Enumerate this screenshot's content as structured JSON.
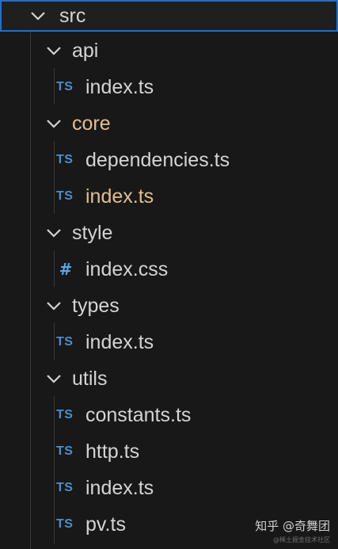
{
  "tree": {
    "root": {
      "label": "src",
      "icon": "chevron-down-icon"
    },
    "folders": [
      {
        "label": "api",
        "files": [
          {
            "label": "index.ts",
            "icon": "TS"
          }
        ]
      },
      {
        "label": "core",
        "files": [
          {
            "label": "dependencies.ts",
            "icon": "TS"
          },
          {
            "label": "index.ts",
            "icon": "TS"
          }
        ]
      },
      {
        "label": "style",
        "files": [
          {
            "label": "index.css",
            "icon": "#"
          }
        ]
      },
      {
        "label": "types",
        "files": [
          {
            "label": "index.ts",
            "icon": "TS"
          }
        ]
      },
      {
        "label": "utils",
        "files": [
          {
            "label": "constants.ts",
            "icon": "TS"
          },
          {
            "label": "http.ts",
            "icon": "TS"
          },
          {
            "label": "index.ts",
            "icon": "TS"
          },
          {
            "label": "pv.ts",
            "icon": "TS"
          }
        ]
      }
    ]
  },
  "watermark": {
    "main": "知乎 @奇舞团",
    "sub": "@稀土掘金技术社区"
  },
  "colors": {
    "background": "#181818",
    "selection_border": "#1e6fcf",
    "ts_icon": "#4d8fcb",
    "css_icon": "#5aa6e6",
    "modified_text": "#e2c08d",
    "text": "#d4d4d4"
  }
}
